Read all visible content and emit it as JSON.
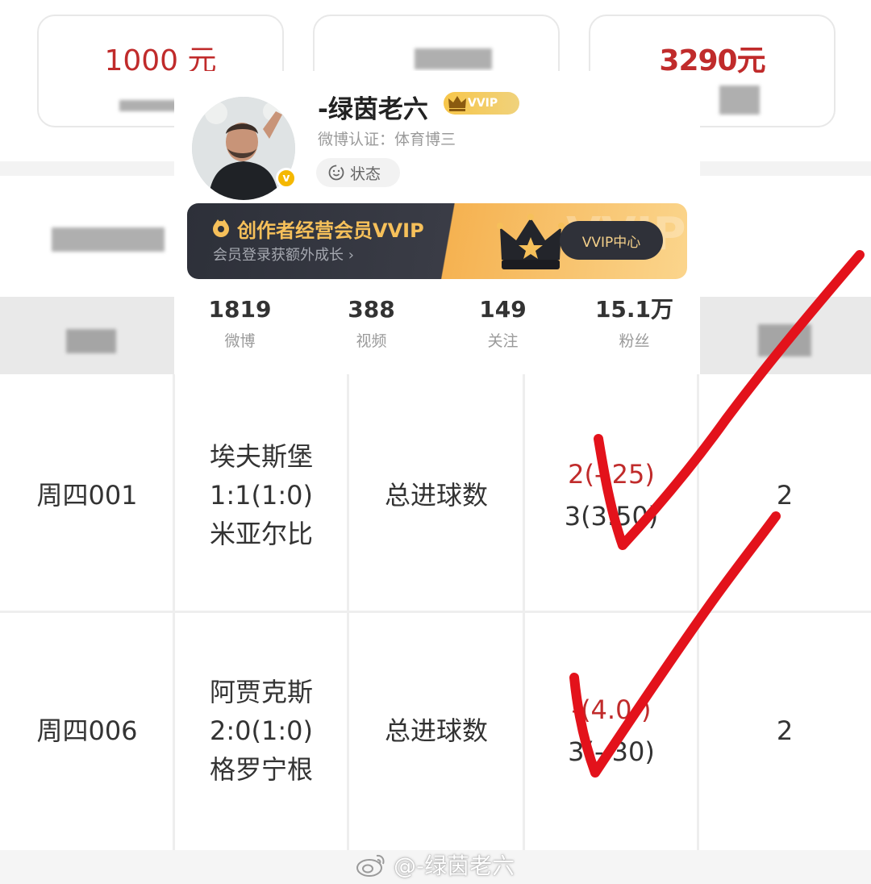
{
  "cards": [
    {
      "amount": "1000 元"
    },
    {
      "amount": ""
    },
    {
      "amount": "3290元"
    }
  ],
  "profile": {
    "username": "-绿茵老六",
    "vvip_badge": "VVIP",
    "verification": "微博认证：体育博三",
    "status_label": "状态",
    "vip_banner": {
      "title": "创作者经营会员VVIP",
      "subtitle": "会员登录获额外成长 ›",
      "watermark": "VVIP",
      "button": "VVIP中心"
    },
    "stats": [
      {
        "value": "1819",
        "label": "微博"
      },
      {
        "value": "388",
        "label": "视频"
      },
      {
        "value": "149",
        "label": "关注"
      },
      {
        "value": "15.1万",
        "label": "粉丝"
      }
    ]
  },
  "table": {
    "rows": [
      {
        "match_no": "周四001",
        "match": [
          "埃夫斯堡",
          "1:1(1:0)",
          "米亚尔比"
        ],
        "play_type": "总进球数",
        "odds": [
          {
            "text": "2(‑.25)",
            "hit": true
          },
          {
            "text": "3(3.50)",
            "hit": false
          }
        ],
        "result": "2"
      },
      {
        "match_no": "周四006",
        "match": [
          "阿贾克斯",
          "2:0(1:0)",
          "格罗宁根"
        ],
        "play_type": "总进球数",
        "odds": [
          {
            "text": "‑(4.0‑)",
            "hit": true
          },
          {
            "text": "3(‑.30)",
            "hit": false
          }
        ],
        "result": "2"
      }
    ]
  },
  "watermark": "@-绿茵老六",
  "colors": {
    "accent_red": "#c02b2b",
    "tick_red": "#e3121b",
    "vip_gold": "#f6c05a",
    "header_grey": "#e9e9e9"
  }
}
